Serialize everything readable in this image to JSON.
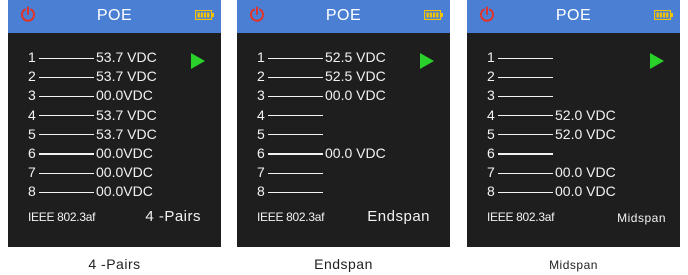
{
  "header": {
    "title": "POE"
  },
  "colors": {
    "header_bg": "#4a7fd3",
    "power_icon": "#e0342b",
    "battery_icon": "#f2c400",
    "arrow": "#2bd12b",
    "screen_bg": "#1e1e1e"
  },
  "icons": {
    "power": "power-icon",
    "battery": "battery-icon",
    "play": "play-arrow-icon"
  },
  "panels": [
    {
      "standard": "IEEE 802.3af",
      "mode": "4 -Pairs",
      "caption": "4 -Pairs",
      "pins": [
        {
          "pin": "1",
          "value": "53.7 VDC"
        },
        {
          "pin": "2",
          "value": "53.7 VDC"
        },
        {
          "pin": "3",
          "value": "00.0VDC"
        },
        {
          "pin": "4",
          "value": "53.7 VDC"
        },
        {
          "pin": "5",
          "value": "53.7 VDC"
        },
        {
          "pin": "6",
          "value": "00.0VDC"
        },
        {
          "pin": "7",
          "value": "00.0VDC"
        },
        {
          "pin": "8",
          "value": "00.0VDC"
        }
      ]
    },
    {
      "standard": "IEEE 802.3af",
      "mode": "Endspan",
      "caption": "Endspan",
      "pins": [
        {
          "pin": "1",
          "value": "52.5 VDC"
        },
        {
          "pin": "2",
          "value": "52.5 VDC"
        },
        {
          "pin": "3",
          "value": "00.0 VDC"
        },
        {
          "pin": "4",
          "value": ""
        },
        {
          "pin": "5",
          "value": ""
        },
        {
          "pin": "6",
          "value": "00.0 VDC"
        },
        {
          "pin": "7",
          "value": ""
        },
        {
          "pin": "8",
          "value": ""
        }
      ]
    },
    {
      "standard": "IEEE 802.3af",
      "mode": "Midspan",
      "caption": "Midspan",
      "pins": [
        {
          "pin": "1",
          "value": ""
        },
        {
          "pin": "2",
          "value": ""
        },
        {
          "pin": "3",
          "value": ""
        },
        {
          "pin": "4",
          "value": "52.0 VDC"
        },
        {
          "pin": "5",
          "value": "52.0 VDC"
        },
        {
          "pin": "6",
          "value": ""
        },
        {
          "pin": "7",
          "value": "00.0 VDC"
        },
        {
          "pin": "8",
          "value": "00.0 VDC"
        }
      ]
    }
  ]
}
